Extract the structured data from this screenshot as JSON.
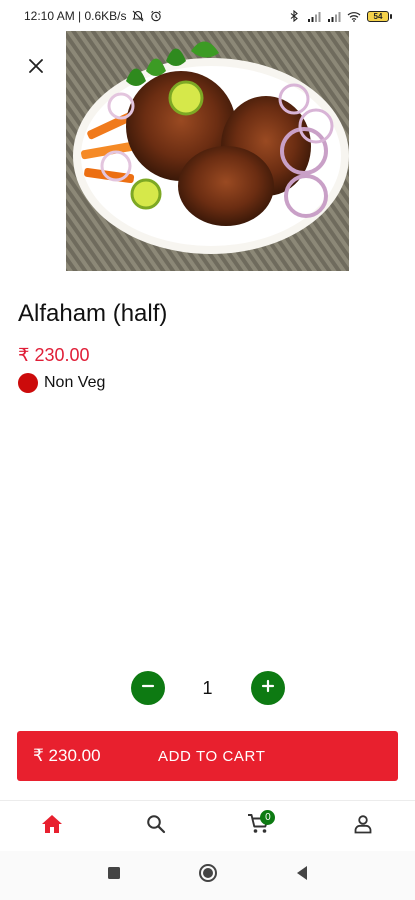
{
  "status_bar": {
    "time_and_speed": "12:10 AM | 0.6KB/s",
    "battery": "54"
  },
  "product": {
    "name": "Alfaham (half)",
    "price": "₹ 230.00",
    "diet_label": "Non Veg"
  },
  "quantity": {
    "value": "1"
  },
  "cart_bar": {
    "total": "₹ 230.00",
    "label": "ADD TO CART"
  },
  "bottom_nav": {
    "cart_count": "0"
  },
  "colors": {
    "accent_red": "#e8202e",
    "price_red": "#e01e37",
    "nonveg_dot": "#cc0b0b",
    "qty_green": "#0d7a12"
  },
  "icons": [
    "close-icon",
    "home-icon",
    "search-icon",
    "cart-icon",
    "user-icon",
    "minus-icon",
    "plus-icon",
    "recent-apps-icon",
    "home-circle-icon",
    "back-icon"
  ]
}
